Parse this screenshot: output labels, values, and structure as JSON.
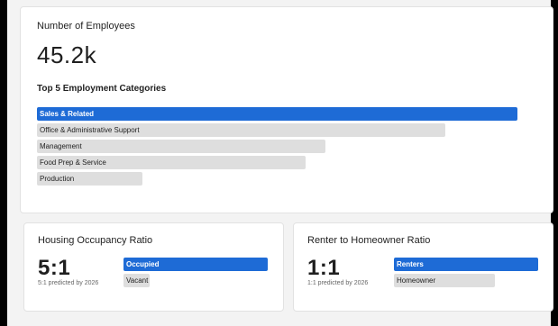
{
  "employees": {
    "title": "Number of Employees",
    "value": "45.2k"
  },
  "categories": {
    "title": "Top 5 Employment Categories",
    "items": [
      {
        "label": "Sales & Related",
        "share": 1.0,
        "highlighted": true
      },
      {
        "label": "Office & Administrative Support",
        "share": 0.85,
        "highlighted": false
      },
      {
        "label": "Management",
        "share": 0.6,
        "highlighted": false
      },
      {
        "label": "Food Prep & Service",
        "share": 0.56,
        "highlighted": false
      },
      {
        "label": "Production",
        "share": 0.22,
        "highlighted": false
      }
    ]
  },
  "housing": {
    "title": "Housing Occupancy Ratio",
    "ratio": "5:1",
    "prediction": "5:1 predicted by 2026",
    "bars": [
      {
        "label": "Occupied",
        "share": 1.0,
        "highlighted": true
      },
      {
        "label": "Vacant",
        "share": 0.18,
        "highlighted": false
      }
    ]
  },
  "renter": {
    "title": "Renter to Homeowner Ratio",
    "ratio": "1:1",
    "prediction": "1:1 predicted by 2026",
    "bars": [
      {
        "label": "Renters",
        "share": 1.0,
        "highlighted": true
      },
      {
        "label": "Homeowner",
        "share": 0.7,
        "highlighted": false
      }
    ]
  },
  "colors": {
    "accent": "#1e6bd6",
    "bar_muted": "#dedede"
  }
}
